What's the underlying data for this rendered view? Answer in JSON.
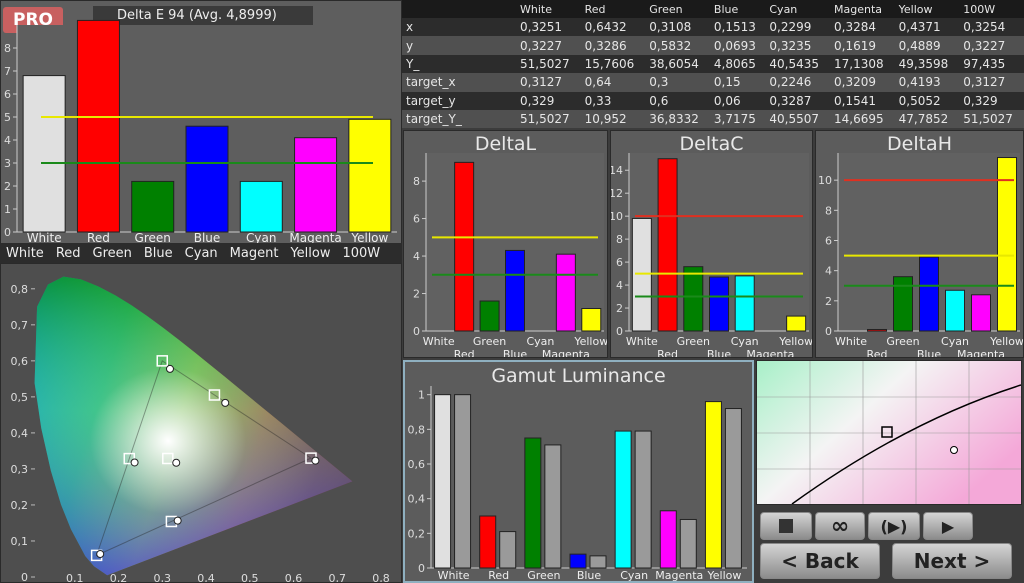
{
  "pro_badge": "PRO",
  "delta_e": {
    "title": "Delta E 94 (Avg. 4,8999)",
    "categories": [
      "White",
      "Red",
      "Green",
      "Blue",
      "Cyan",
      "Magenta",
      "Yellow"
    ],
    "y_ticks": [
      "0",
      "1",
      "2",
      "3",
      "4",
      "5",
      "6",
      "7",
      "8"
    ]
  },
  "legend_strip": [
    "White",
    "Red",
    "Green",
    "Blue",
    "Cyan",
    "Magent",
    "Yellow",
    "100W"
  ],
  "table": {
    "columns": [
      "",
      "White",
      "Red",
      "Green",
      "Blue",
      "Cyan",
      "Magenta",
      "Yellow",
      "100W"
    ],
    "rows": [
      [
        "x",
        "0,3251",
        "0,6432",
        "0,3108",
        "0,1513",
        "0,2299",
        "0,3284",
        "0,4371",
        "0,3254"
      ],
      [
        "y",
        "0,3227",
        "0,3286",
        "0,5832",
        "0,0693",
        "0,3235",
        "0,1619",
        "0,4889",
        "0,3227"
      ],
      [
        "Y_",
        "51,5027",
        "15,7606",
        "38,6054",
        "4,8065",
        "40,5435",
        "17,1308",
        "49,3598",
        "97,435"
      ],
      [
        "target_x",
        "0,3127",
        "0,64",
        "0,3",
        "0,15",
        "0,2246",
        "0,3209",
        "0,4193",
        "0,3127"
      ],
      [
        "target_y",
        "0,329",
        "0,33",
        "0,6",
        "0,06",
        "0,3287",
        "0,1541",
        "0,5052",
        "0,329"
      ],
      [
        "target_Y_",
        "51,5027",
        "10,952",
        "36,8332",
        "3,7175",
        "40,5507",
        "14,6695",
        "47,7852",
        "51,5027"
      ]
    ]
  },
  "delta_l": {
    "title": "DeltaL",
    "y_ticks": [
      "0",
      "2",
      "4",
      "6",
      "8"
    ],
    "cat_top": [
      "White",
      "Green",
      "Cyan",
      "Yellow"
    ],
    "cat_bottom": [
      "Red",
      "Blue",
      "Magenta"
    ]
  },
  "delta_c": {
    "title": "DeltaC",
    "y_ticks": [
      "0",
      "2",
      "4",
      "6",
      "8",
      "10",
      "12",
      "14"
    ],
    "cat_top": [
      "White",
      "Green",
      "Cyan",
      "Yellow"
    ],
    "cat_bottom": [
      "Red",
      "Blue",
      "Magenta"
    ]
  },
  "delta_h": {
    "title": "DeltaH",
    "y_ticks": [
      "0",
      "2",
      "4",
      "6",
      "8",
      "10"
    ],
    "cat_top": [
      "White",
      "Green",
      "Cyan",
      "Yellow"
    ],
    "cat_bottom": [
      "Red",
      "Blue",
      "Magenta"
    ]
  },
  "gamut": {
    "title": "Gamut Luminance",
    "y_ticks": [
      "0",
      "0,2",
      "0,4",
      "0,6",
      "0,8",
      "1"
    ],
    "categories": [
      "White",
      "Red",
      "Green",
      "Blue",
      "Cyan",
      "Magenta",
      "Yellow"
    ]
  },
  "cie": {
    "y_ticks": [
      "0",
      "0,1",
      "0,2",
      "0,3",
      "0,4",
      "0,5",
      "0,6",
      "0,7",
      "0,8"
    ],
    "x_ticks": [
      "0,1",
      "0,2",
      "0,3",
      "0,4",
      "0,5",
      "0,6",
      "0,7",
      "0,8"
    ]
  },
  "buttons": {
    "back": "< Back",
    "next": "Next >",
    "loop": "∞"
  },
  "chart_data": [
    {
      "type": "bar",
      "title": "Delta E 94 (Avg. 4,8999)",
      "categories": [
        "White",
        "Red",
        "Green",
        "Blue",
        "Cyan",
        "Magenta",
        "Yellow"
      ],
      "values": [
        6.8,
        9.2,
        2.2,
        4.6,
        2.2,
        4.1,
        4.9
      ],
      "colors": [
        "#e0e0e0",
        "#ff0000",
        "#008000",
        "#0000ff",
        "#00ffff",
        "#ff00ff",
        "#ffff00"
      ],
      "ylim": [
        0,
        9
      ],
      "reference_lines": [
        5,
        3
      ]
    },
    {
      "type": "bar",
      "title": "DeltaL",
      "categories": [
        "White",
        "Red",
        "Green",
        "Blue",
        "Cyan",
        "Magenta",
        "Yellow"
      ],
      "values": [
        0,
        9.0,
        1.6,
        4.3,
        0,
        4.1,
        1.2
      ],
      "ylim": [
        0,
        9.5
      ],
      "reference_lines": [
        5,
        3
      ]
    },
    {
      "type": "bar",
      "title": "DeltaC",
      "categories": [
        "White",
        "Red",
        "Green",
        "Blue",
        "Cyan",
        "Magenta",
        "Yellow"
      ],
      "values": [
        9.8,
        15.0,
        5.6,
        4.7,
        4.8,
        0,
        1.3
      ],
      "ylim": [
        0,
        15.5
      ],
      "reference_lines": [
        10,
        5,
        3
      ]
    },
    {
      "type": "bar",
      "title": "DeltaH",
      "categories": [
        "White",
        "Red",
        "Green",
        "Blue",
        "Cyan",
        "Magenta",
        "Yellow"
      ],
      "values": [
        0,
        0.1,
        3.6,
        4.9,
        2.7,
        2.4,
        11.5
      ],
      "ylim": [
        0,
        11.8
      ],
      "reference_lines": [
        10,
        5,
        3
      ]
    },
    {
      "type": "bar",
      "title": "Gamut Luminance",
      "categories": [
        "White",
        "Red",
        "Green",
        "Blue",
        "Cyan",
        "Magenta",
        "Yellow"
      ],
      "series": [
        {
          "values": [
            1.0,
            0.3,
            0.75,
            0.08,
            0.79,
            0.33,
            0.96
          ]
        },
        {
          "values": [
            1.0,
            0.21,
            0.71,
            0.07,
            0.79,
            0.28,
            0.92
          ]
        }
      ],
      "ylim": [
        0,
        1.05
      ]
    },
    {
      "type": "scatter",
      "title": "",
      "measured": [
        [
          0.3251,
          0.3227
        ],
        [
          0.6432,
          0.3286
        ],
        [
          0.3108,
          0.5832
        ],
        [
          0.1513,
          0.0693
        ],
        [
          0.2299,
          0.3235
        ],
        [
          0.3284,
          0.1619
        ],
        [
          0.4371,
          0.4889
        ]
      ],
      "target": [
        [
          0.3127,
          0.329
        ],
        [
          0.64,
          0.33
        ],
        [
          0.3,
          0.6
        ],
        [
          0.15,
          0.06
        ],
        [
          0.2246,
          0.3287
        ],
        [
          0.3209,
          0.1541
        ],
        [
          0.4193,
          0.5052
        ]
      ],
      "xlim": [
        0,
        0.85
      ],
      "ylim": [
        0,
        0.85
      ]
    }
  ]
}
